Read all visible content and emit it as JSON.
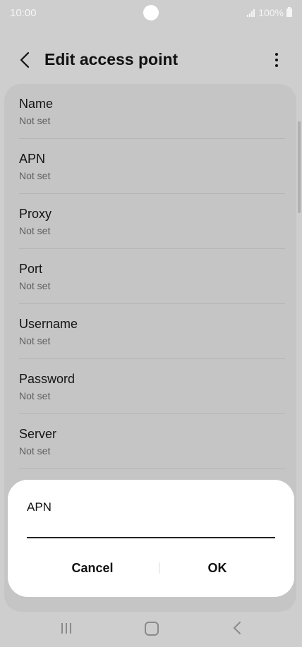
{
  "status_bar": {
    "time": "10:00",
    "battery": "100%"
  },
  "app_bar": {
    "title": "Edit access point"
  },
  "fields": [
    {
      "label": "Name",
      "value": "Not set"
    },
    {
      "label": "APN",
      "value": "Not set"
    },
    {
      "label": "Proxy",
      "value": "Not set"
    },
    {
      "label": "Port",
      "value": "Not set"
    },
    {
      "label": "Username",
      "value": "Not set"
    },
    {
      "label": "Password",
      "value": "Not set"
    },
    {
      "label": "Server",
      "value": "Not set"
    }
  ],
  "dialog": {
    "title": "APN",
    "input_value": "",
    "cancel_label": "Cancel",
    "ok_label": "OK"
  },
  "colors": {
    "dim_background": "#cecece",
    "dialog_background": "#ffffff"
  }
}
